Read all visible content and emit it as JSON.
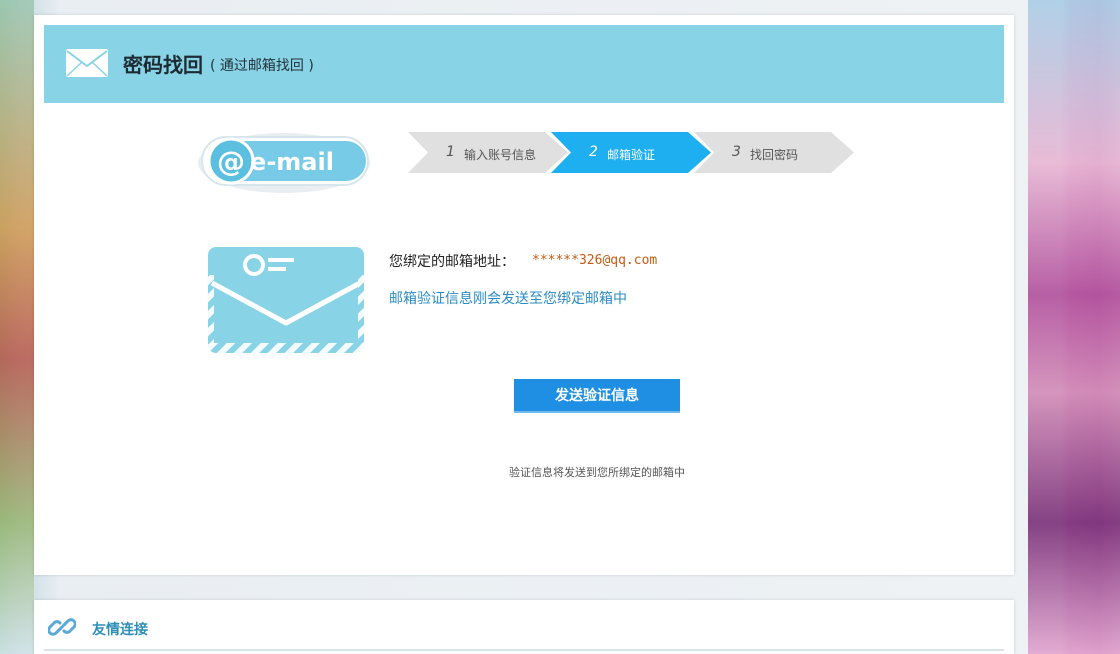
{
  "header": {
    "title": "密码找回",
    "subtitle": "( 通过邮箱找回 )",
    "icon": "envelope-icon"
  },
  "logo": {
    "text": "@e-mail",
    "icon": "email-logo"
  },
  "steps": [
    {
      "number": "1",
      "label": "输入账号信息",
      "active": false
    },
    {
      "number": "2",
      "label": "邮箱验证",
      "active": true
    },
    {
      "number": "3",
      "label": "找回密码",
      "active": false
    }
  ],
  "content": {
    "bound_label": "您绑定的邮箱地址：",
    "bound_email": "******326@qq.com",
    "notice": "邮箱验证信息刚会发送至您绑定邮箱中",
    "send_button": "发送验证信息",
    "hint": "验证信息将发送到您所绑定的邮箱中"
  },
  "links": {
    "title": "友情连接",
    "icon": "link-icon"
  },
  "colors": {
    "header_bg": "#89d3e6",
    "step_active": "#1eaff0",
    "step_inactive": "#e0e0e0",
    "button": "#1e8fe3",
    "email_text": "#c55a11",
    "notice_text": "#2a8cc4"
  }
}
